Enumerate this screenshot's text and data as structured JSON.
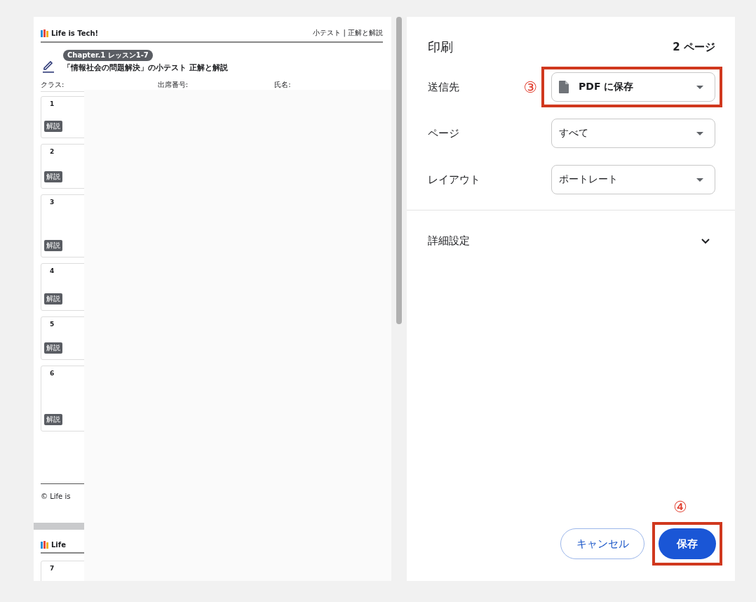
{
  "preview": {
    "pages": [
      {
        "logo": "Life is Tech!",
        "header_right": "小テスト | 正解と解説",
        "badge": "Chapter.1 レッスン1-7",
        "title": "「情報社会の問題解決」の小テスト 正解と解説",
        "fields": [
          "クラス:",
          "出席番号:",
          "氏名:"
        ],
        "questions": [
          {
            "number": "1",
            "tag": "解説"
          },
          {
            "number": "2",
            "tag": "解説"
          },
          {
            "number": "3",
            "tag": "解説"
          },
          {
            "number": "4",
            "tag": "解説"
          },
          {
            "number": "5",
            "tag": "解説"
          },
          {
            "number": "6",
            "tag": "解説"
          }
        ],
        "footer": "© Life is"
      },
      {
        "logo": "Life",
        "questions": [
          {
            "number": "7"
          }
        ]
      }
    ]
  },
  "print_panel": {
    "title": "印刷",
    "page_count": "2 ページ",
    "settings": [
      {
        "label": "送信先",
        "value": "PDF に保存",
        "kind": "destination",
        "annotation": "③",
        "highlighted": true
      },
      {
        "label": "ページ",
        "value": "すべて",
        "kind": "plain",
        "highlighted": false
      },
      {
        "label": "レイアウト",
        "value": "ポートレート",
        "kind": "plain",
        "highlighted": false
      }
    ],
    "more_settings": {
      "label": "詳細設定",
      "expanded": false
    },
    "buttons": [
      {
        "label": "キャンセル",
        "kind": "secondary",
        "highlighted": false
      },
      {
        "label": "保存",
        "kind": "primary",
        "annotation": "④",
        "highlighted": true
      }
    ]
  }
}
